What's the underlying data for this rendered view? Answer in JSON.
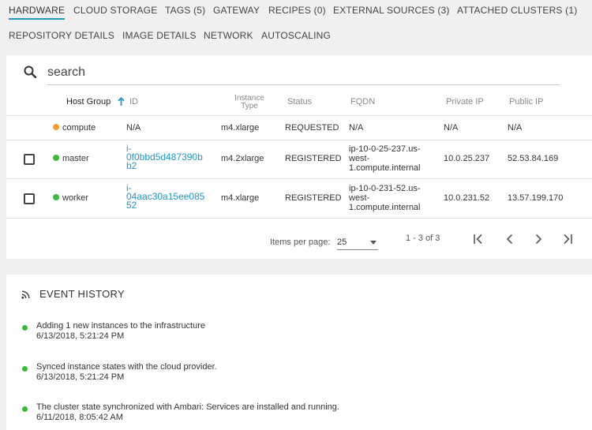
{
  "tabs": [
    {
      "label": "HARDWARE",
      "active": true
    },
    {
      "label": "CLOUD STORAGE"
    },
    {
      "label": "TAGS (5)"
    },
    {
      "label": "GATEWAY"
    },
    {
      "label": "RECIPES (0)"
    },
    {
      "label": "EXTERNAL SOURCES (3)"
    },
    {
      "label": "ATTACHED CLUSTERS (1)"
    },
    {
      "label": "REPOSITORY DETAILS"
    },
    {
      "label": "IMAGE DETAILS"
    },
    {
      "label": "NETWORK"
    },
    {
      "label": "AUTOSCALING"
    }
  ],
  "search": {
    "placeholder": "search"
  },
  "table": {
    "headers": {
      "host_group": "Host Group",
      "id": "ID",
      "instance_type_line1": "Instance",
      "instance_type_line2": "Type",
      "status": "Status",
      "fqdn": "FQDN",
      "private_ip": "Private IP",
      "public_ip": "Public IP"
    },
    "rows": [
      {
        "host_group": "compute",
        "dot_color": "#f39c33",
        "id_lines": [
          "N/A"
        ],
        "instance_type": "m4.xlarge",
        "status": "REQUESTED",
        "fqdn_lines": [
          "N/A"
        ],
        "private_ip": "N/A",
        "public_ip": "N/A",
        "has_checkbox": false,
        "id_link": false
      },
      {
        "host_group": "master",
        "dot_color": "#3db83d",
        "id_lines": [
          "i-",
          "0f0bbd5d487390b",
          "b2"
        ],
        "instance_type": "m4.2xlarge",
        "status": "REGISTERED",
        "fqdn_lines": [
          "ip-10-0-25-237.us-",
          "west-",
          "1.compute.internal"
        ],
        "private_ip": "10.0.25.237",
        "public_ip": "52.53.84.169",
        "has_checkbox": true,
        "id_link": true
      },
      {
        "host_group": "worker",
        "dot_color": "#3db83d",
        "id_lines": [
          "i-",
          "04aac30a15ee085",
          "52"
        ],
        "instance_type": "m4.xlarge",
        "status": "REGISTERED",
        "fqdn_lines": [
          "ip-10-0-231-52.us-",
          "west-",
          "1.compute.internal"
        ],
        "private_ip": "10.0.231.52",
        "public_ip": "13.57.199.170",
        "has_checkbox": true,
        "id_link": true
      }
    ]
  },
  "pager": {
    "items_per_page_label": "Items per page:",
    "items_per_page_value": "25",
    "range": "1 - 3 of 3"
  },
  "events": {
    "title": "EVENT HISTORY",
    "items": [
      {
        "text": "Adding 1 new instances to the infrastructure",
        "time": "6/13/2018, 5:21:24 PM"
      },
      {
        "text": "Synced instance states with the cloud provider.",
        "time": "6/13/2018, 5:21:24 PM"
      },
      {
        "text": "The cluster state synchronized with Ambari: Services are installed and running.",
        "time": "6/11/2018, 8:05:42 AM"
      }
    ]
  },
  "colors": {
    "accent": "#2196c9",
    "green": "#3db83d",
    "orange": "#f39c33"
  }
}
